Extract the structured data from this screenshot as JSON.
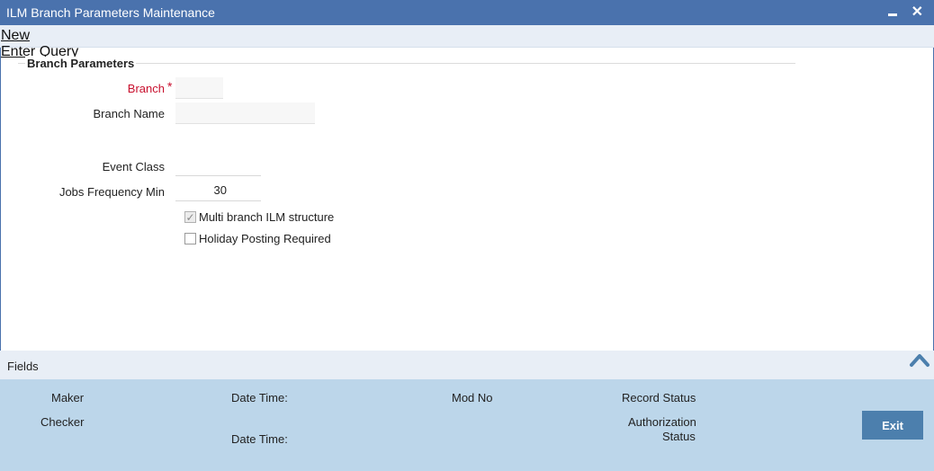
{
  "window": {
    "title": "ILM Branch Parameters Maintenance",
    "minimize_glyph": "",
    "close_glyph": "✕"
  },
  "menu": {
    "new_label": "New",
    "enter_query_label": "Enter Query"
  },
  "section": {
    "title": "Branch Parameters"
  },
  "form": {
    "branch_label": "Branch",
    "required_marker": "*",
    "branch_value": "",
    "branch_name_label": "Branch Name",
    "branch_name_value": "",
    "event_class_label": "Event Class",
    "event_class_value": "",
    "jobs_frequency_label": "Jobs Frequency Min",
    "jobs_frequency_value": "30",
    "multi_branch_label": "Multi branch ILM structure",
    "multi_branch_checked": true,
    "holiday_posting_label": "Holiday Posting Required",
    "holiday_posting_checked": false
  },
  "fields_bar": {
    "label": "Fields",
    "icon": "chevron-up-icon"
  },
  "audit": {
    "maker_label": "Maker",
    "checker_label": "Checker",
    "date_time_label_1": "Date Time:",
    "date_time_label_2": "Date Time:",
    "mod_no_label": "Mod No",
    "record_status_label": "Record Status",
    "authorization_label_line1": "Authorization",
    "authorization_label_line2": "Status"
  },
  "exit_button": {
    "label": "Exit"
  },
  "colors": {
    "titlebar": "#4a72ad",
    "audit_panel": "#bcd6ea",
    "exit_button": "#4c7fad",
    "required_label": "#c8102e"
  }
}
